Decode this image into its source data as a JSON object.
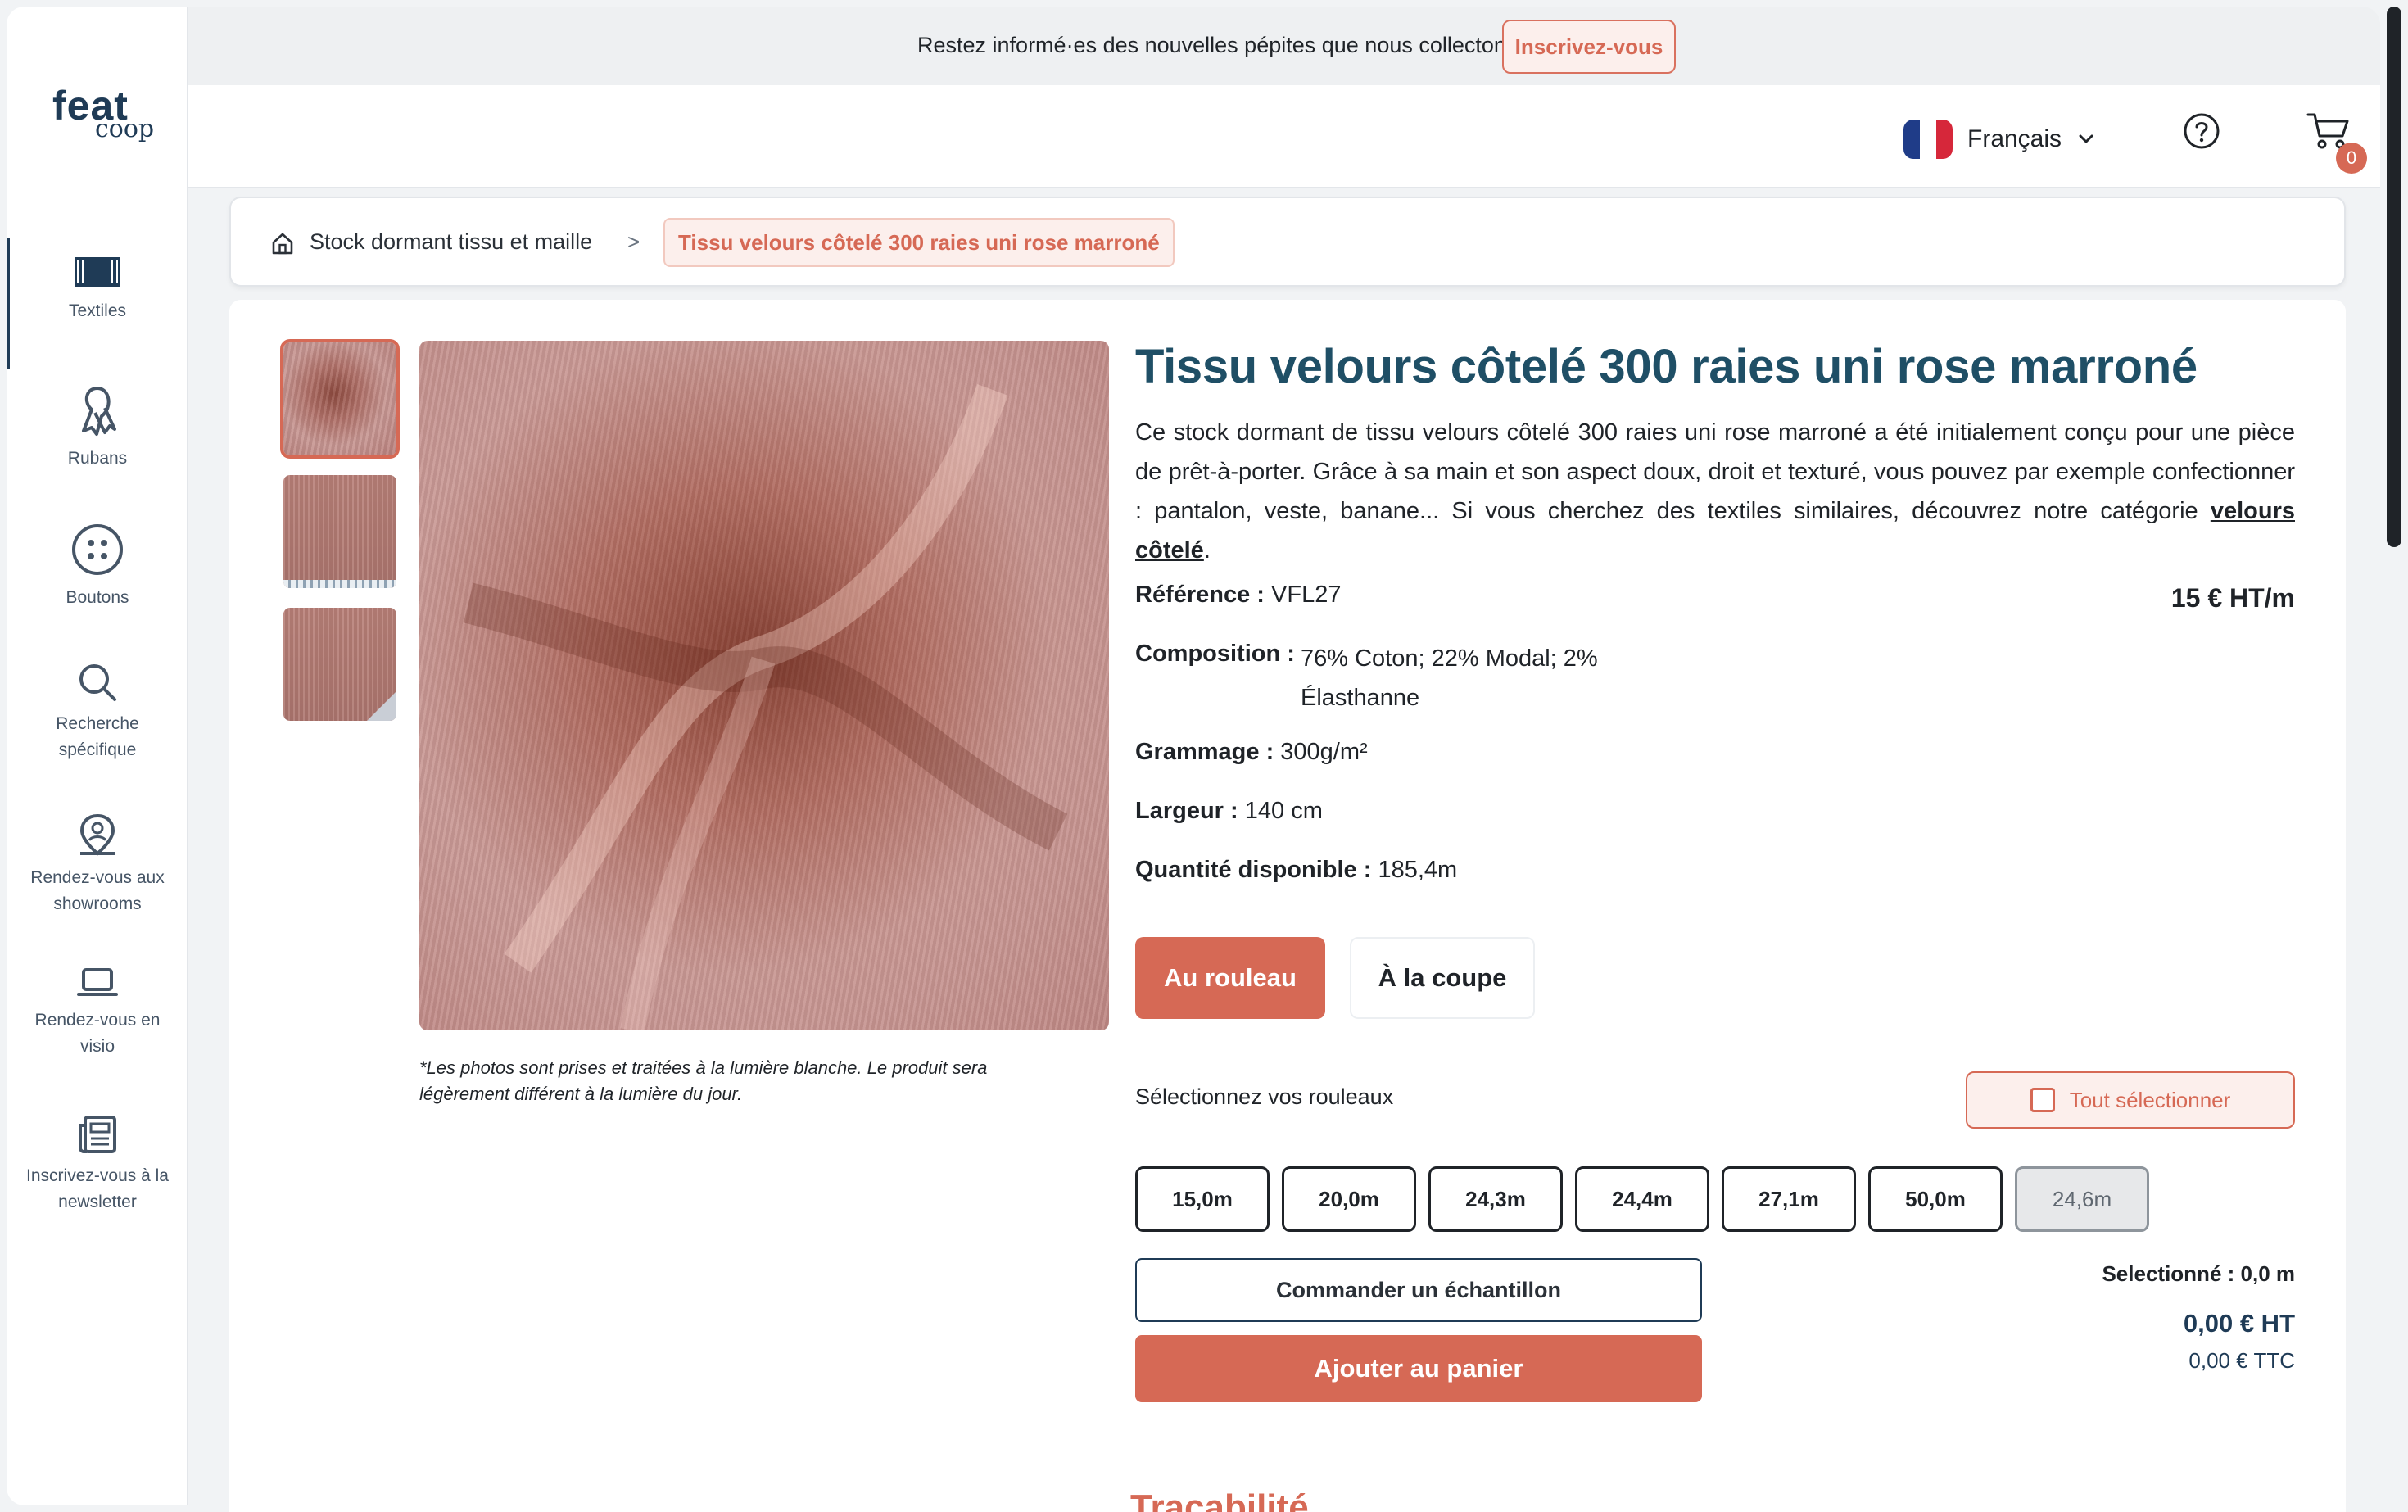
{
  "banner": {
    "text": "Restez informé·es des nouvelles pépites que nous collectons !",
    "cta": "Inscrivez-vous",
    "close_icon": "close-icon"
  },
  "logo": {
    "line1": "feat",
    "line2": "coop"
  },
  "sidebar": {
    "items": [
      {
        "label": "Textiles",
        "icon": "textile-roll-icon",
        "active": true
      },
      {
        "label": "Rubans",
        "icon": "ribbon-icon"
      },
      {
        "label": "Boutons",
        "icon": "button-icon"
      },
      {
        "label": "Recherche spécifique",
        "icon": "search-icon"
      },
      {
        "label": "Rendez-vous aux showrooms",
        "icon": "location-person-icon"
      },
      {
        "label": "Rendez-vous en visio",
        "icon": "laptop-icon"
      },
      {
        "label": "Inscrivez-vous à la newsletter",
        "icon": "newspaper-icon"
      }
    ]
  },
  "header": {
    "language": "Français",
    "flag_colors": [
      "#1f3c88",
      "#ffffff",
      "#d6273a"
    ],
    "help_icon": "help-circle-icon",
    "cart_icon": "cart-icon",
    "cart_count": "0"
  },
  "breadcrumb": {
    "home": "Stock dormant tissu et maille",
    "separator": ">",
    "current": "Tissu velours côtelé 300 raies uni rose marroné"
  },
  "product": {
    "title": "Tissu velours côtelé 300 raies uni rose marroné",
    "description_main": "Ce stock dormant de tissu velours côtelé 300 raies uni rose marroné a été initialement conçu pour une pièce de prêt-à-porter. Grâce à sa main et son aspect doux, droit et texturé, vous pouvez par exemple confectionner : pantalon, veste, banane... Si vous cherchez des textiles similaires, découvrez notre catégorie ",
    "description_link": "velours côtelé",
    "description_end": ".",
    "photo_note": "*Les photos sont prises et traitées à la lumière blanche. Le produit sera légèrement différent à la lumière du jour.",
    "reference_label": "Référence :",
    "reference_value": "VFL27",
    "price": "15 € HT/m",
    "composition_label": "Composition :",
    "composition_value": "76% Coton; 22% Modal; 2% Élasthanne",
    "grammage_label": "Grammage :",
    "grammage_value": "300g/m²",
    "largeur_label": "Largeur :",
    "largeur_value": "140 cm",
    "quantite_label": "Quantité disponible :",
    "quantite_value": "185,4m"
  },
  "purchase": {
    "mode_roll": "Au rouleau",
    "mode_cut": "À la coupe",
    "select_label": "Sélectionnez vos rouleaux",
    "select_all": "Tout sélectionner",
    "rolls": [
      {
        "label": "15,0m",
        "disabled": false
      },
      {
        "label": "20,0m",
        "disabled": false
      },
      {
        "label": "24,3m",
        "disabled": false
      },
      {
        "label": "24,4m",
        "disabled": false
      },
      {
        "label": "27,1m",
        "disabled": false
      },
      {
        "label": "50,0m",
        "disabled": false
      },
      {
        "label": "24,6m",
        "disabled": true
      }
    ],
    "sample_button": "Commander un échantillon",
    "add_to_cart": "Ajouter au panier",
    "selected": "Selectionné : 0,0 m",
    "total_ht": "0,00 € HT",
    "total_ttc": "0,00 € TTC"
  },
  "next_section_heading": "Traçabilité",
  "colors": {
    "accent": "#d66955",
    "brand_dark": "#1f3b56",
    "title": "#1f4f66"
  }
}
